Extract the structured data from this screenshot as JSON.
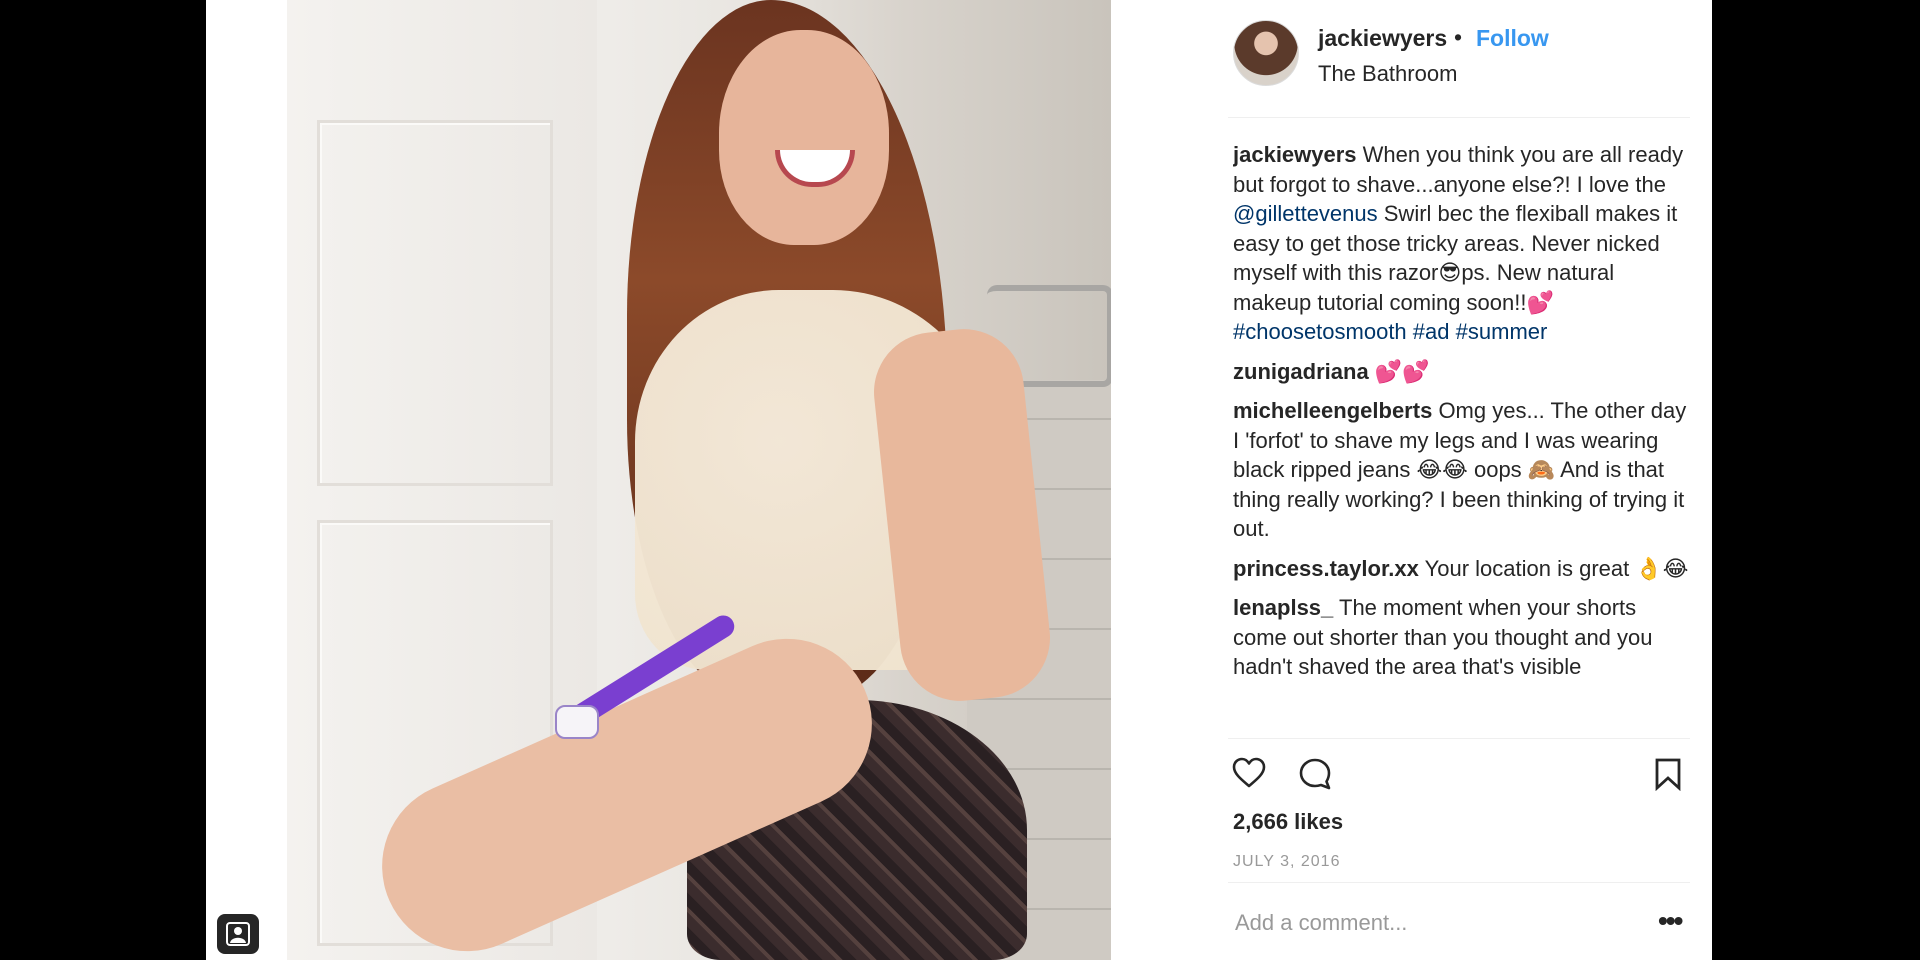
{
  "post": {
    "username": "jackiewyers",
    "dot": "•",
    "follow_label": "Follow",
    "location": "The Bathroom"
  },
  "comments": [
    {
      "user": "jackiewyers",
      "parts": [
        {
          "t": "text",
          "v": "When you think you are all ready but forgot to shave...anyone else?! I love the "
        },
        {
          "t": "link",
          "v": "@gillettevenus"
        },
        {
          "t": "text",
          "v": " Swirl bec the flexiball makes it easy to get those tricky areas. Never nicked myself with this razor😎ps. New natural makeup tutorial coming soon!!💕"
        },
        {
          "t": "link",
          "v": "#choosetosmooth"
        },
        {
          "t": "text",
          "v": " "
        },
        {
          "t": "link",
          "v": "#ad"
        },
        {
          "t": "text",
          "v": " "
        },
        {
          "t": "link",
          "v": "#summer"
        }
      ]
    },
    {
      "user": "zunigadriana",
      "parts": [
        {
          "t": "text",
          "v": "💕💕"
        }
      ]
    },
    {
      "user": "michelleengelberts",
      "parts": [
        {
          "t": "text",
          "v": "Omg yes... The other day I 'forfot' to shave my legs and I was wearing black ripped jeans 😂😂 oops 🙈 And is that thing really working? I been thinking of trying it out."
        }
      ]
    },
    {
      "user": "princess.taylor.xx",
      "parts": [
        {
          "t": "text",
          "v": "Your location is great 👌😂"
        }
      ]
    },
    {
      "user": "lenaplss_",
      "parts": [
        {
          "t": "text",
          "v": "The moment when your shorts come out shorter than you thought and you hadn't shaved the area that's visible"
        }
      ]
    }
  ],
  "actions": {
    "likes": "2,666 likes",
    "date": "JULY 3, 2016"
  },
  "add_comment": {
    "placeholder": "Add a comment...",
    "more": "•••"
  },
  "icons": [
    "heart-icon",
    "comment-icon",
    "bookmark-icon",
    "person-icon",
    "more-icon"
  ],
  "colors": {
    "follow": "#3897f0",
    "link": "#003569",
    "text": "#262626",
    "muted": "#999999"
  }
}
